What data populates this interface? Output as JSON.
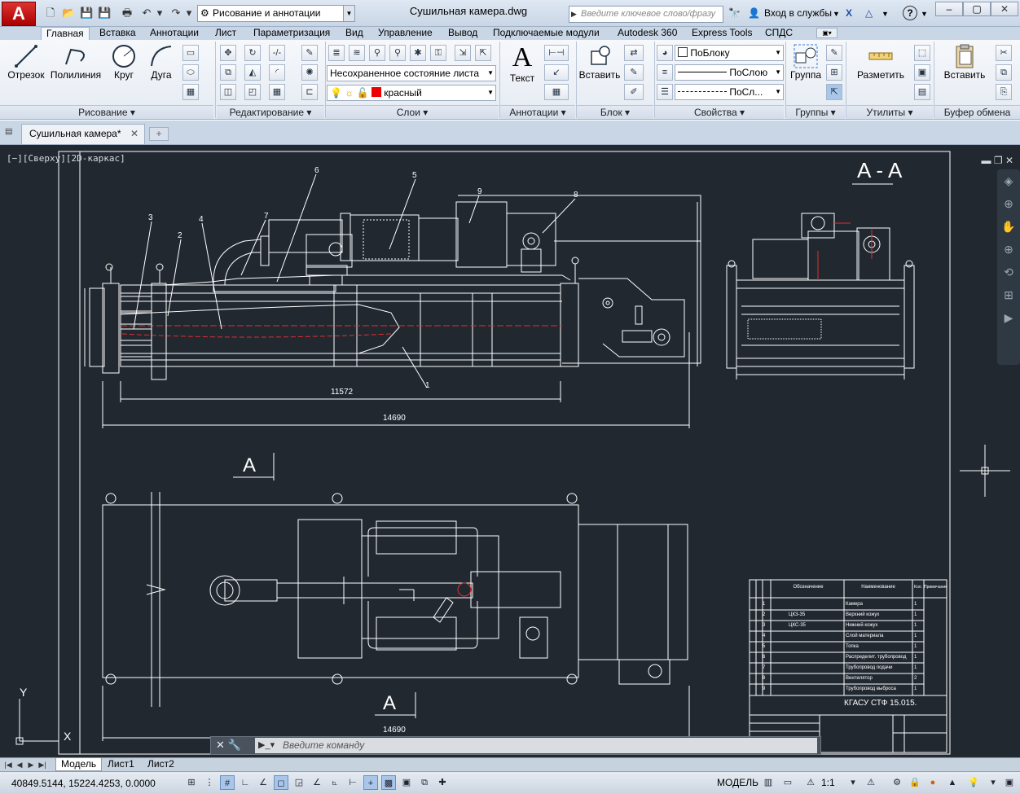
{
  "titlebar": {
    "app_logo": "A",
    "workspace": "Рисование и аннотации",
    "doc_title": "Сушильная камера.dwg",
    "search_placeholder": "Введите ключевое слово/фразу",
    "signin": "Вход в службы",
    "help": "?"
  },
  "tabs": [
    "Главная",
    "Вставка",
    "Аннотации",
    "Лист",
    "Параметризация",
    "Вид",
    "Управление",
    "Вывод",
    "Подключаемые модули",
    "Autodesk 360",
    "Express Tools",
    "СПДС"
  ],
  "ribbon": {
    "draw": {
      "line": "Отрезок",
      "polyline": "Полилиния",
      "circle": "Круг",
      "arc": "Дуга",
      "panel": "Рисование"
    },
    "modify": {
      "panel": "Редактирование"
    },
    "layers": {
      "state": "Несохраненное состояние листа",
      "current_layer": "красный",
      "panel": "Слои"
    },
    "annotation": {
      "text": "Текст",
      "panel": "Аннотации"
    },
    "block": {
      "insert": "Вставить",
      "panel": "Блок"
    },
    "properties": {
      "color": "ПоБлоку",
      "linetype": "ПоСлою",
      "lineweight": "ПоСл...",
      "panel": "Свойства"
    },
    "groups": {
      "group": "Группа",
      "panel": "Группы"
    },
    "utilities": {
      "measure": "Разметить",
      "panel": "Утилиты"
    },
    "clipboard": {
      "paste": "Вставить",
      "panel": "Буфер обмена"
    }
  },
  "filetab": {
    "name": "Сушильная камера*"
  },
  "viewport": {
    "label": "[−][Сверху][2D-каркас]",
    "section_label": "А-А",
    "dims": {
      "d1": "11572",
      "d2": "14690",
      "d3": "14690"
    },
    "callouts": [
      "1",
      "2",
      "3",
      "4",
      "5",
      "6",
      "7",
      "8",
      "9"
    ],
    "section_mark": "А",
    "title_block": {
      "headers": [
        "Обозначение",
        "Наименование",
        "Кол.",
        "Примечание"
      ],
      "rows": [
        {
          "pos": "1",
          "code": "",
          "name": "Камера",
          "qty": "1"
        },
        {
          "pos": "2",
          "code": "ЦКЗ-35",
          "name": "Верхний кожух",
          "qty": "1"
        },
        {
          "pos": "3",
          "code": "ЦКС-35",
          "name": "Нижний кожух",
          "qty": "1"
        },
        {
          "pos": "4",
          "code": "",
          "name": "Слой материала",
          "qty": "1"
        },
        {
          "pos": "5",
          "code": "",
          "name": "Топка",
          "qty": "1"
        },
        {
          "pos": "6",
          "code": "",
          "name": "Распределит. трубопровод",
          "qty": "1"
        },
        {
          "pos": "7",
          "code": "",
          "name": "Трубопровод подачи",
          "qty": "1"
        },
        {
          "pos": "8",
          "code": "",
          "name": "Вентилятор",
          "qty": "2"
        },
        {
          "pos": "9",
          "code": "",
          "name": "Трубопровод выброса",
          "qty": "1"
        }
      ],
      "stamp": "КГАСУ СТФ 15.015."
    }
  },
  "command": {
    "placeholder": "Введите команду"
  },
  "layout_tabs": [
    "Модель",
    "Лист1",
    "Лист2"
  ],
  "status": {
    "coords": "40849.5144, 15224.4253, 0.0000",
    "model": "МОДЕЛЬ",
    "scale": "1:1"
  },
  "colors": {
    "viewport_bg": "#212830",
    "drawing_lines": "#ffffff",
    "red": "#e02020"
  }
}
